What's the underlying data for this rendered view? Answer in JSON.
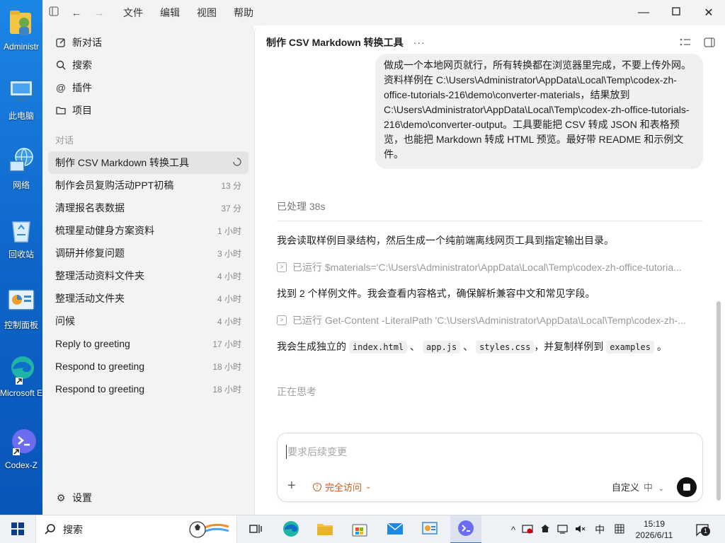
{
  "desktop": {
    "icons": [
      {
        "label": "Administr",
        "icon": "user-folder-icon"
      },
      {
        "label": "此电脑",
        "icon": "computer-icon"
      },
      {
        "label": "网络",
        "icon": "network-icon"
      },
      {
        "label": "回收站",
        "icon": "recycle-bin-icon"
      },
      {
        "label": "控制面板",
        "icon": "control-panel-icon"
      },
      {
        "label": "Microsoft Edge",
        "icon": "edge-icon"
      },
      {
        "label": "Codex-Z",
        "icon": "codex-icon"
      }
    ]
  },
  "titlebar": {
    "menus": [
      "文件",
      "编辑",
      "视图",
      "帮助"
    ]
  },
  "sidebar": {
    "nav": [
      {
        "label": "新对话",
        "icon": "edit-icon"
      },
      {
        "label": "搜索",
        "icon": "search-icon"
      },
      {
        "label": "插件",
        "icon": "at-icon"
      },
      {
        "label": "项目",
        "icon": "folder-icon"
      }
    ],
    "section_label": "对话",
    "conversations": [
      {
        "title": "制作 CSV Markdown 转换工具",
        "time": ""
      },
      {
        "title": "制作会员复购活动PPT初稿",
        "time": "13 分"
      },
      {
        "title": "清理报名表数据",
        "time": "37 分"
      },
      {
        "title": "梳理星动健身方案资料",
        "time": "1 小时"
      },
      {
        "title": "调研并修复问题",
        "time": "3 小时"
      },
      {
        "title": "整理活动资料文件夹",
        "time": "4 小时"
      },
      {
        "title": "整理活动文件夹",
        "time": "4 小时"
      },
      {
        "title": "问候",
        "time": "4 小时"
      },
      {
        "title": "Reply to greeting",
        "time": "17 小时"
      },
      {
        "title": "Respond to greeting",
        "time": "18 小时"
      },
      {
        "title": "Respond to greeting",
        "time": "18 小时"
      }
    ],
    "settings_label": "设置"
  },
  "main": {
    "title": "制作 CSV Markdown 转换工具",
    "more": "···",
    "user_message": "做成一个本地网页就行，所有转换都在浏览器里完成，不要上传外网。资料样例在 C:\\Users\\Administrator\\AppData\\Local\\Temp\\codex-zh-office-tutorials-216\\demo\\converter-materials，结果放到 C:\\Users\\Administrator\\AppData\\Local\\Temp\\codex-zh-office-tutorials-216\\demo\\converter-output。工具要能把 CSV 转成 JSON 和表格预览，也能把 Markdown 转成 HTML 预览。最好带 README 和示例文件。",
    "processed": "已处理 38s",
    "para1": "我会读取样例目录结构，然后生成一个纯前端离线网页工具到指定输出目录。",
    "ran1": "已运行 $materials='C:\\Users\\Administrator\\AppData\\Local\\Temp\\codex-zh-office-tutoria...",
    "para2": "找到 2 个样例文件。我会查看内容格式，确保解析兼容中文和常见字段。",
    "ran2": "已运行 Get-Content -LiteralPath 'C:\\Users\\Administrator\\AppData\\Local\\Temp\\codex-zh-...",
    "para3": {
      "prefix": "我会生成独立的",
      "file1": "index.html",
      "sep1": "、",
      "file2": "app.js",
      "sep2": "、",
      "file3": "styles.css",
      "mid": "，并复制样例到",
      "file4": "examples",
      "end": "。"
    },
    "thinking": "正在思考"
  },
  "composer": {
    "placeholder": "要求后续变更",
    "access_label": "完全访问",
    "model_label": "自定义",
    "model_sub": "中"
  },
  "taskbar": {
    "search_label": "搜索",
    "ime": "中",
    "time": "15:19",
    "date": "2026/6/11",
    "notifications": "1"
  }
}
